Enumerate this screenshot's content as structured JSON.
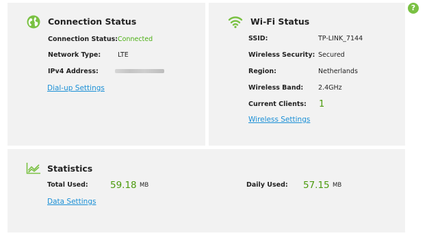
{
  "help": {
    "label": "?"
  },
  "connection": {
    "title": "Connection Status",
    "icon": "globe-icon",
    "rows": [
      {
        "label": "Connection Status:",
        "value": "Connected"
      },
      {
        "label": "Network Type:",
        "value": "LTE"
      },
      {
        "label": "IPv4 Address:",
        "value": ""
      }
    ],
    "link": "Dial-up Settings"
  },
  "wifi": {
    "title": "Wi-Fi Status",
    "icon": "wifi-icon",
    "rows": [
      {
        "label": "SSID:",
        "value": "TP-LINK_7144"
      },
      {
        "label": "Wireless Security:",
        "value": "Secured"
      },
      {
        "label": "Region:",
        "value": "Netherlands"
      },
      {
        "label": "Wireless Band:",
        "value": "2.4GHz"
      },
      {
        "label": "Current Clients:",
        "value": "1"
      }
    ],
    "link": "Wireless Settings"
  },
  "stats": {
    "title": "Statistics",
    "icon": "chart-line-icon",
    "total_label": "Total Used:",
    "total_value": "59.18",
    "total_unit": "MB",
    "daily_label": "Daily Used:",
    "daily_value": "57.15",
    "daily_unit": "MB",
    "link": "Data Settings"
  },
  "colors": {
    "accent": "#7ac143",
    "ok_text": "#4caf14",
    "link": "#1a8fd6",
    "panel_bg": "#f2f2f2"
  }
}
